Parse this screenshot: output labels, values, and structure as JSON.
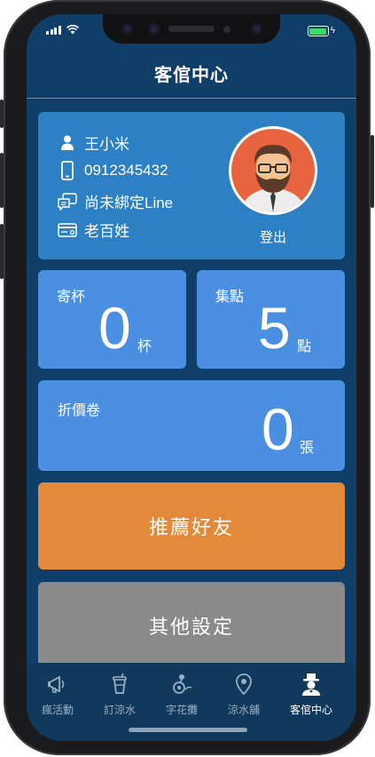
{
  "header": {
    "title": "客倌中心"
  },
  "profile": {
    "name": "王小米",
    "phone": "0912345432",
    "line_status": "尚未綁定Line",
    "member_level": "老百姓",
    "logout_label": "登出"
  },
  "stats": {
    "cups": {
      "label": "寄杯",
      "value": "0",
      "unit": "杯"
    },
    "points": {
      "label": "集點",
      "value": "5",
      "unit": "點"
    },
    "coupons": {
      "label": "折價卷",
      "value": "0",
      "unit": "張"
    }
  },
  "actions": {
    "recommend_label": "推薦好友",
    "settings_label": "其他設定"
  },
  "tabs": [
    {
      "label": "瘋活動",
      "icon": "megaphone-icon"
    },
    {
      "label": "訂涼水",
      "icon": "drink-cup-icon"
    },
    {
      "label": "字花攤",
      "icon": "flower-vendor-icon"
    },
    {
      "label": "涼水舖",
      "icon": "location-pin-icon"
    },
    {
      "label": "客倌中心",
      "icon": "user-hat-icon"
    }
  ],
  "colors": {
    "background": "#0f3f68",
    "profile_card": "#2e80c5",
    "stat_card": "#4a8fe2",
    "recommend_button": "#e38a3a",
    "settings_button": "#8a8a8a",
    "tab_active": "#ffffff",
    "tab_inactive": "#9ab0c5"
  }
}
